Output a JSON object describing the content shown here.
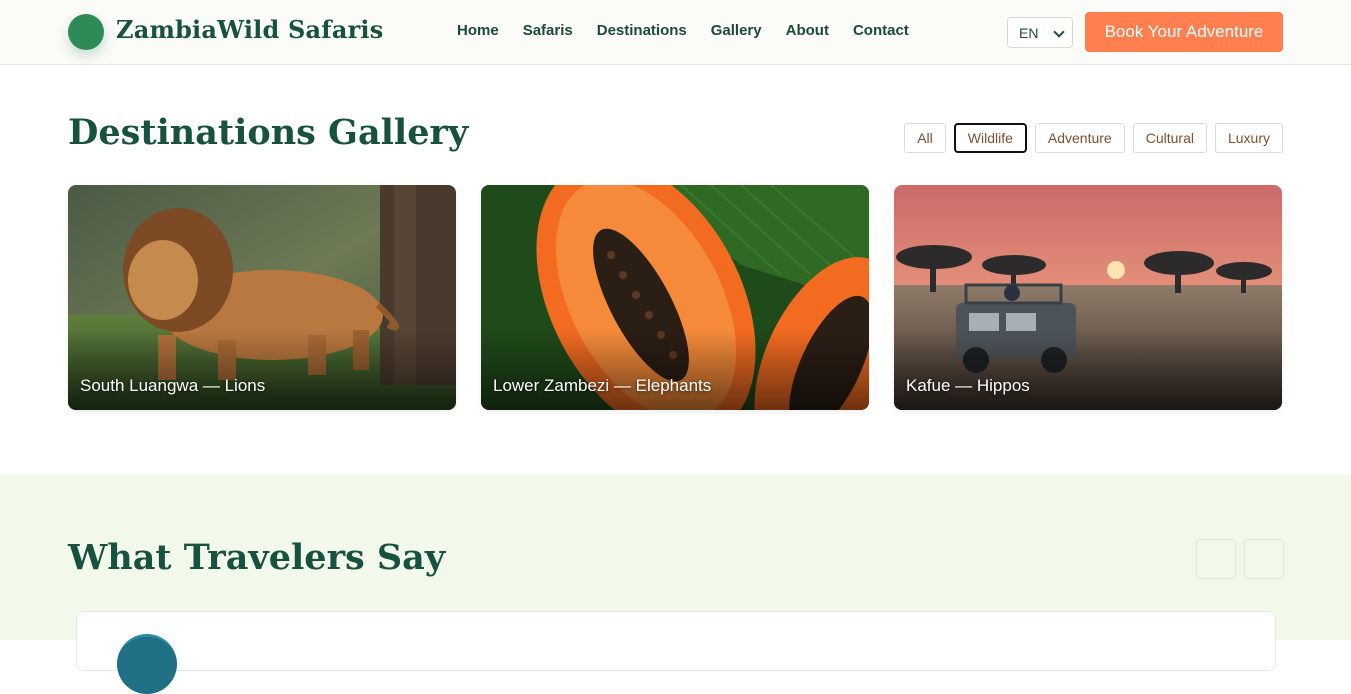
{
  "brand": {
    "name": "ZambiaWild Safaris",
    "logo_color": "#2e8b57"
  },
  "nav": {
    "items": [
      "Home",
      "Safaris",
      "Destinations",
      "Gallery",
      "About",
      "Contact"
    ]
  },
  "language": {
    "selected": "EN"
  },
  "cta": {
    "label": "Book Your Adventure",
    "color": "#ff7f50"
  },
  "gallery": {
    "title": "Destinations Gallery",
    "filters": [
      "All",
      "Wildlife",
      "Adventure",
      "Cultural",
      "Luxury"
    ],
    "active_filter": "Wildlife",
    "cards": [
      {
        "caption": "South Luangwa — Lions",
        "image": "lion-photo"
      },
      {
        "caption": "Lower Zambezi — Elephants",
        "image": "papaya-photo"
      },
      {
        "caption": "Kafue — Hippos",
        "image": "safari-sunset-photo"
      }
    ]
  },
  "testimonials": {
    "title": "What Travelers Say",
    "background": "#f2f8ea"
  }
}
